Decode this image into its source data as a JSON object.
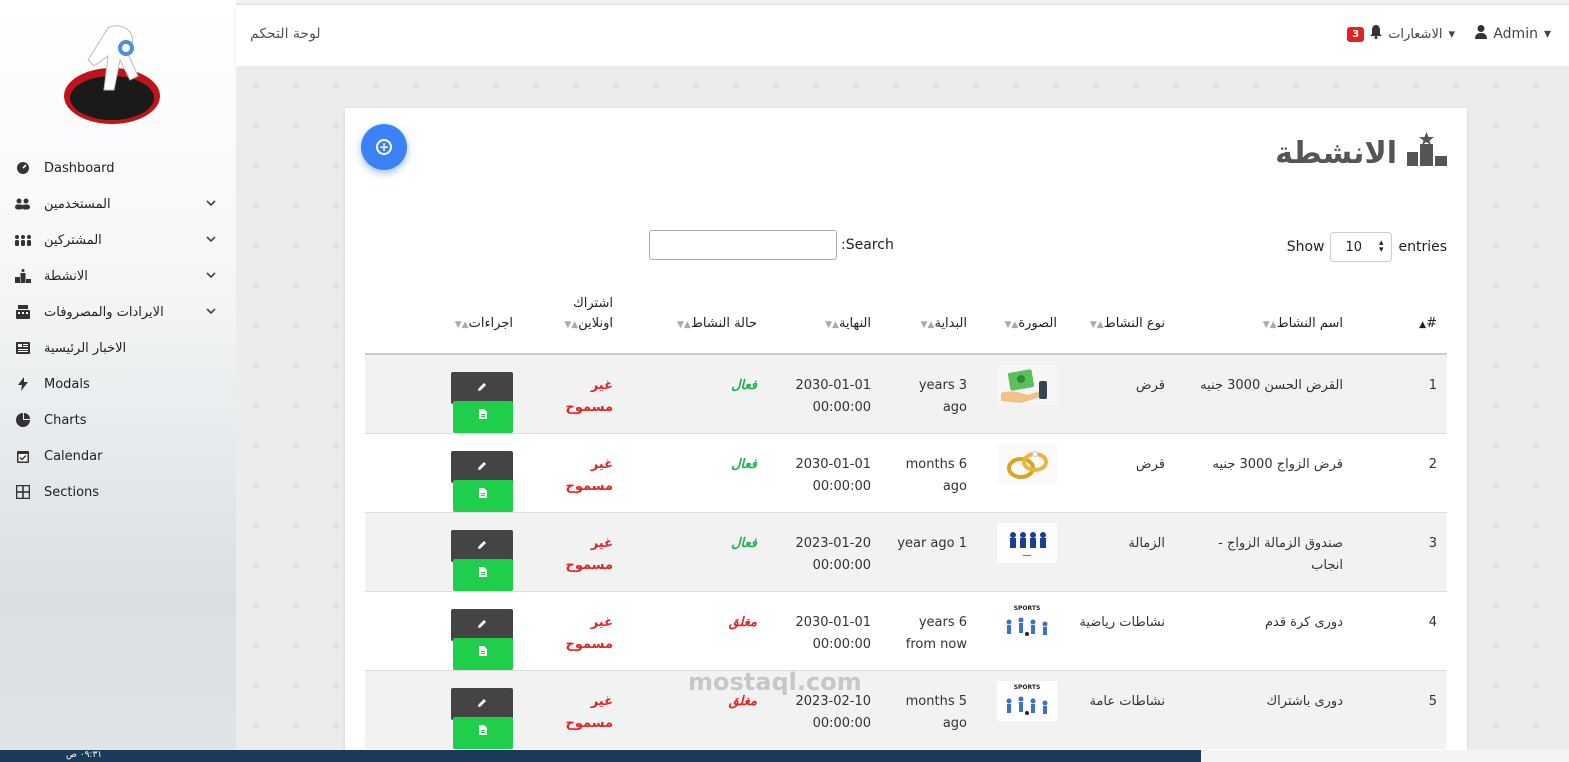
{
  "topbar": {
    "title": "لوحة التحكم",
    "admin_label": "Admin",
    "notifications_label": "الاشعارات",
    "notifications_count": "3"
  },
  "sidebar": {
    "items": [
      {
        "label": "Dashboard",
        "icon": "gauge-icon",
        "has_chevron": false
      },
      {
        "label": "المستخدمين",
        "icon": "users-icon",
        "has_chevron": true
      },
      {
        "label": "المشتركين",
        "icon": "people-group-icon",
        "has_chevron": true
      },
      {
        "label": "الانشطة",
        "icon": "podium-icon",
        "has_chevron": true
      },
      {
        "label": "الايرادات والمصروفات",
        "icon": "cash-register-icon",
        "has_chevron": true
      },
      {
        "label": "الاخبار الرئيسية",
        "icon": "newspaper-icon",
        "has_chevron": false
      },
      {
        "label": "Modals",
        "icon": "bolt-icon",
        "has_chevron": false
      },
      {
        "label": "Charts",
        "icon": "pie-chart-icon",
        "has_chevron": false
      },
      {
        "label": "Calendar",
        "icon": "calendar-icon",
        "has_chevron": false
      },
      {
        "label": "Sections",
        "icon": "grid-icon",
        "has_chevron": false
      }
    ]
  },
  "card": {
    "title": "الانشطة",
    "search_label": ":Search",
    "show_label": "Show",
    "entries_label": "entries",
    "page_size": "10"
  },
  "table": {
    "headers": [
      "#",
      "اسم النشاط",
      "نوع النشاط",
      "الصورة",
      "البداية",
      "النهاية",
      "حالة النشاط",
      "اشتراك اونلاين",
      "اجراءات"
    ],
    "rows": [
      {
        "num": "1",
        "name": "القرض الحسن 3000 جنيه",
        "type": "قرض",
        "image": "money-hand",
        "start": "years 3 ago",
        "end": "2030-01-01 00:00:00",
        "status": "فعال",
        "status_on": true,
        "online": "غير مسموح"
      },
      {
        "num": "2",
        "name": "قرض الزواج 3000 جنيه",
        "type": "قرض",
        "image": "rings",
        "start": "months 6 ago",
        "end": "2030-01-01 00:00:00",
        "status": "فعال",
        "status_on": true,
        "online": "غير مسموح"
      },
      {
        "num": "3",
        "name": "صندوق الزمالة الزواج - انجاب",
        "type": "الزمالة",
        "image": "people",
        "start": "year ago 1",
        "end": "2023-01-20 00:00:00",
        "status": "فعال",
        "status_on": true,
        "online": "غير مسموح"
      },
      {
        "num": "4",
        "name": "دورى كرة قدم",
        "type": "نشاطات رياضية",
        "image": "sports",
        "start": "years 6 from now",
        "end": "2030-01-01 00:00:00",
        "status": "مغلق",
        "status_on": false,
        "online": "غير مسموح"
      },
      {
        "num": "5",
        "name": "دورى باشتراك",
        "type": "نشاطات عامة",
        "image": "sports",
        "start": "months 5 ago",
        "end": "2023-02-10 00:00:00",
        "status": "مغلق",
        "status_on": false,
        "online": "غير مسموح"
      }
    ]
  },
  "watermark": "mostaql.com",
  "taskbar_time": "٠٩:٣١ ص"
}
